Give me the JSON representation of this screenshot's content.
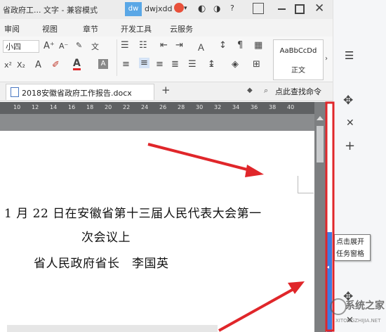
{
  "window": {
    "title": "省政府工... 文字 - 兼容模式",
    "account_badge": "dw",
    "account_name": "dwjxdd",
    "help_label": "?"
  },
  "menu": [
    "审阅",
    "视图",
    "章节",
    "开发工具",
    "云服务"
  ],
  "ribbon": {
    "font_size": "小四",
    "style_preview": "AaBbCcDd",
    "style_name": "正文"
  },
  "document_tab": {
    "filename": "2018安徽省政府工作报告.docx",
    "add_label": "+",
    "search_label": "点此查找命令"
  },
  "ruler_ticks": [
    "10",
    "12",
    "14",
    "16",
    "18",
    "20",
    "22",
    "24",
    "26",
    "28",
    "30",
    "32",
    "34",
    "36",
    "38",
    "40"
  ],
  "document_text": {
    "line1": "1 月 22 日在安徽省第十三届人民代表大会第一",
    "line2": "次会议上",
    "line3": "省人民政府省长　李国英"
  },
  "tooltip": {
    "text": "点击展开任务窗格"
  },
  "side_icons": [
    "list-icon",
    "move-icon",
    "close-icon",
    "plus-icon"
  ],
  "watermark": {
    "text": "系统之家",
    "url": "XITONGZHIJIA.NET"
  },
  "colors": {
    "accent_blue": "#3f7be0",
    "annotation_red": "#e0262a",
    "titlebar_blue": "#5aa7e6"
  }
}
